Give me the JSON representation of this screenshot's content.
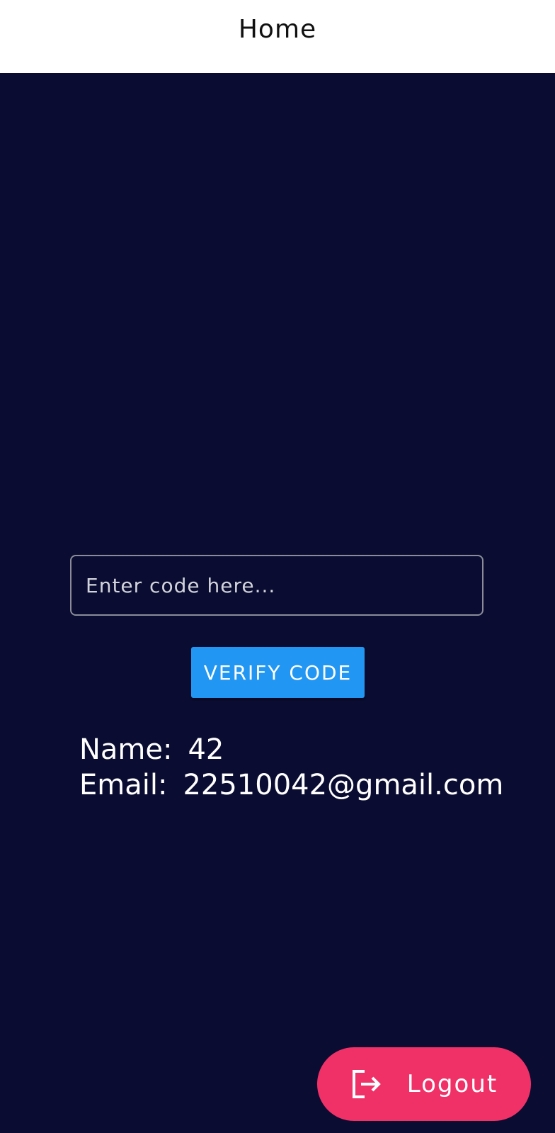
{
  "header": {
    "title": "Home"
  },
  "form": {
    "code_placeholder": "Enter code here...",
    "code_value": "",
    "verify_label": "VERIFY CODE"
  },
  "profile": {
    "name_label": "Name:",
    "name_value": "42",
    "email_label": "Email:",
    "email_value": "22510042@gmail.com"
  },
  "fab": {
    "logout_label": "Logout",
    "icon": "logout-icon"
  },
  "colors": {
    "background": "#0a0c31",
    "header_bg": "#ffffff",
    "verify_button": "#2196f3",
    "logout_button": "#f03168"
  }
}
